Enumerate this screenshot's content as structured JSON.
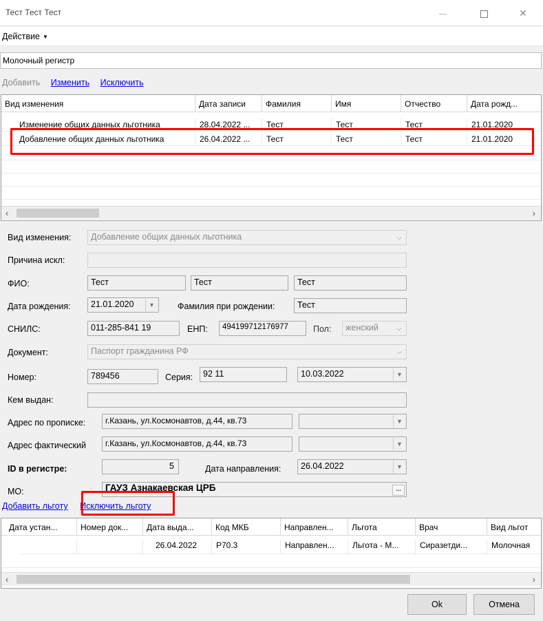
{
  "window": {
    "title": "Тест Тест Тест"
  },
  "menu": {
    "action": "Действие"
  },
  "register": {
    "selected": "Молочный регистр"
  },
  "links": {
    "add": "Добавить",
    "edit": "Изменить",
    "exclude": "Исключить"
  },
  "changes_table": {
    "columns": [
      "Вид изменения",
      "Дата записи",
      "Фамилия",
      "Имя",
      "Отчество",
      "Дата рожд..."
    ],
    "rows": [
      [
        "Изменение общих данных льготника",
        "28.04.2022 ...",
        "Тест",
        "Тест",
        "Тест",
        "21.01.2020"
      ],
      [
        "Добавление общих данных льготника",
        "26.04.2022 ...",
        "Тест",
        "Тест",
        "Тест",
        "21.01.2020"
      ]
    ]
  },
  "form": {
    "change_type_label": "Вид изменения:",
    "change_type_value": "Добавление общих данных льготника",
    "reason_label": "Причина искл:",
    "reason_value": "",
    "fio_label": "ФИО:",
    "last_name": "Тест",
    "first_name": "Тест",
    "patronymic": "Тест",
    "birth_label": "Дата рождения:",
    "birth_value": "21.01.2020",
    "birth_name_label": "Фамилия при рождении:",
    "birth_name_value": "Тест",
    "snils_label": "СНИЛС:",
    "snils_value": "011-285-841 19",
    "enp_label": "ЕНП:",
    "enp_value": "494199712176977",
    "sex_label": "Пол:",
    "sex_value": "женский",
    "doc_label": "Документ:",
    "doc_value": "Паспорт гражданина РФ",
    "number_label": "Номер:",
    "number_value": "789456",
    "series_label": "Серия:",
    "series_value": "92 11",
    "issue_date": "10.03.2022",
    "issued_by_label": "Кем выдан:",
    "issued_by_value": "",
    "reg_addr_label": "Адрес по прописке:",
    "reg_addr_value": "г.Казань, ул.Космонавтов, д.44, кв.73",
    "fact_addr_label": "Адрес фактический",
    "fact_addr_value": "г.Казань, ул.Космонавтов, д.44, кв.73",
    "id_label": "ID в регистре:",
    "id_value": "5",
    "referral_date_label": "Дата направления:",
    "referral_date_value": "26.04.2022",
    "mo_label": "МО:",
    "mo_value": "ГАУЗ Азнакаевская ЦРБ"
  },
  "benefit_links": {
    "add": "Добавить льготу",
    "exclude": "Исключить льготу"
  },
  "benefits_table": {
    "columns": [
      "Дата устан...",
      "Номер док...",
      "Дата выда...",
      "Код МКБ",
      "Направлен...",
      "Льгота",
      "Врач",
      "Вид льгот"
    ],
    "rows": [
      [
        "",
        "",
        "26.04.2022",
        "P70.3",
        "Направлен...",
        "Льгота - М...",
        "Сиразетди...",
        "Молочная"
      ]
    ]
  },
  "buttons": {
    "ok": "Ok",
    "cancel": "Отмена"
  }
}
